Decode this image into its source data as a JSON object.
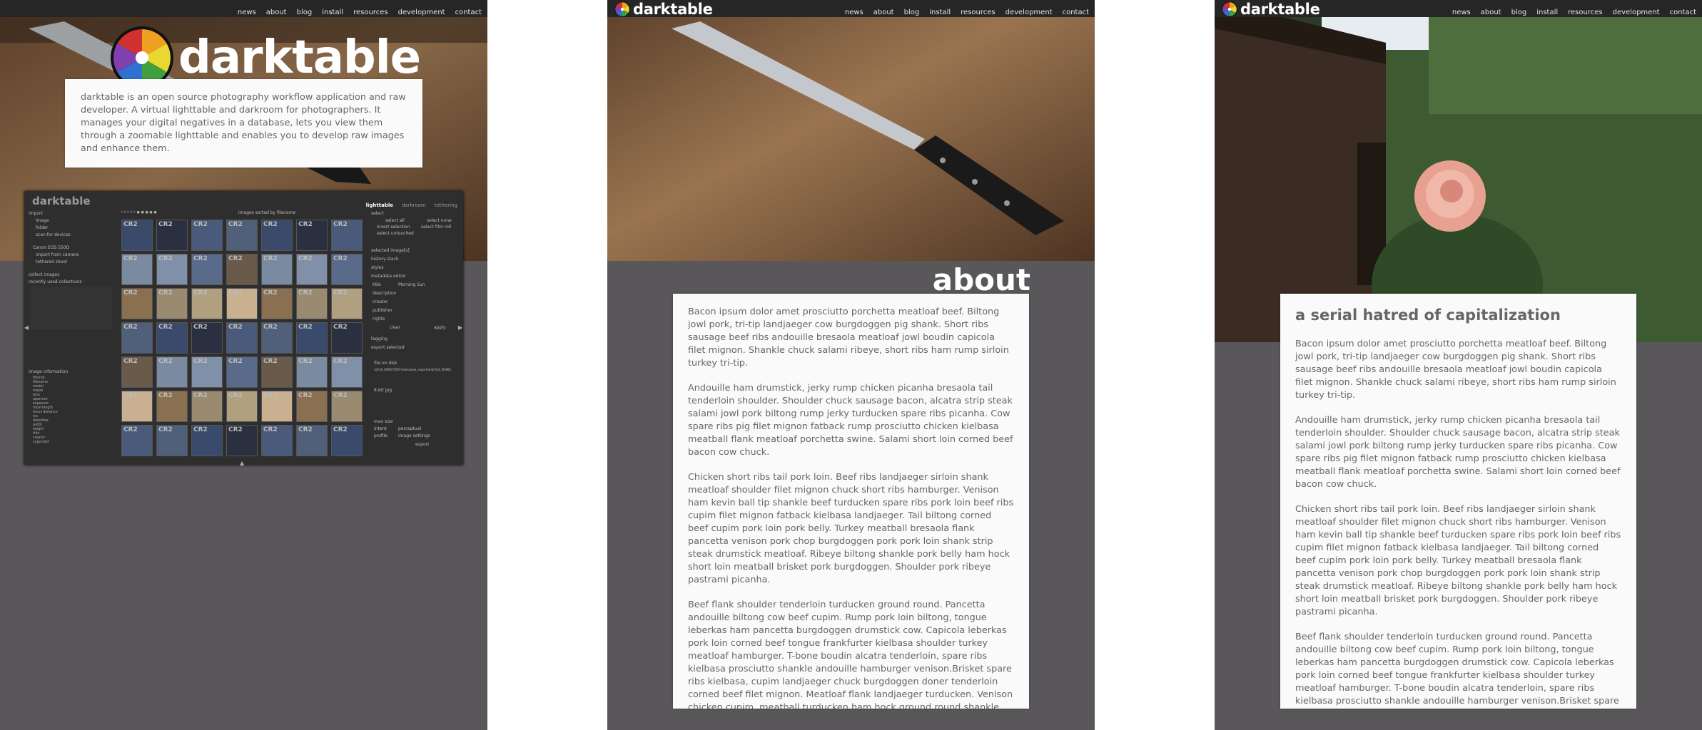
{
  "nav": {
    "items": [
      "news",
      "about",
      "blog",
      "install",
      "resources",
      "development",
      "contact"
    ]
  },
  "brand": {
    "name": "darktable"
  },
  "home": {
    "intro": "darktable is an open source photography workflow application and raw developer. A virtual lighttable and darkroom for photographers. It manages your digital negatives in a database, lets you view them through a zoomable lighttable and enables you to develop raw images and enhance them."
  },
  "app_screenshot": {
    "title": "darktable",
    "views": [
      "lighttable",
      "darkroom",
      "tethering"
    ],
    "sort_label": "images sorted by",
    "sort_value": "filename",
    "left_panel": {
      "import": "import",
      "import_items": [
        "image",
        "folder",
        "scan for devices"
      ],
      "device": "Canon EOS 550D",
      "device_items": [
        "import from camera",
        "tethered shoot"
      ],
      "collect": "collect images",
      "recent": "recently used collections",
      "image_info": "image information",
      "info_labels": [
        "filmroll",
        "filename",
        "model",
        "maker",
        "lens",
        "aperture",
        "exposure",
        "focal length",
        "focus distance",
        "iso",
        "datetime",
        "width",
        "height",
        "title",
        "creator",
        "copyright"
      ]
    },
    "right_panel": {
      "select": "select",
      "select_buttons": [
        "select all",
        "select none",
        "invert selection",
        "select film roll",
        "select untouched"
      ],
      "sections": [
        "selected image[s]",
        "history stack",
        "styles",
        "metadata editor",
        "tagging",
        "export selected"
      ],
      "metadata_fields": [
        "title",
        "description",
        "creator",
        "publisher",
        "rights"
      ],
      "metadata_title": "Morning Sun",
      "clear": "clear",
      "apply": "apply",
      "target": "file on disk",
      "path": "$(FILE_DIRECTORY)/darktable_exported/$(FILE_NAME)",
      "format": "8-bit jpg",
      "size": "max size",
      "intent": "intent",
      "profile": "profile",
      "profile_value": "image settings",
      "intent_value": "perceptual",
      "export": "export"
    },
    "thumb_label": "CR2"
  },
  "about": {
    "heading": "about",
    "paragraphs": [
      "Bacon ipsum dolor amet prosciutto porchetta meatloaf beef. Biltong jowl pork, tri-tip landjaeger cow burgdoggen pig shank. Short ribs sausage beef ribs andouille bresaola meatloaf jowl boudin capicola filet mignon. Shankle chuck salami ribeye, short ribs ham rump sirloin turkey tri-tip.",
      "Andouille ham drumstick, jerky rump chicken picanha bresaola tail tenderloin shoulder. Shoulder chuck sausage bacon, alcatra strip steak salami jowl pork biltong rump jerky turducken spare ribs picanha. Cow spare ribs pig filet mignon fatback rump prosciutto chicken kielbasa meatball flank meatloaf porchetta swine. Salami short loin corned beef bacon cow chuck.",
      "Chicken short ribs tail pork loin. Beef ribs landjaeger sirloin shank meatloaf shoulder filet mignon chuck short ribs hamburger. Venison ham kevin ball tip shankle beef turducken spare ribs pork loin beef ribs cupim filet mignon fatback kielbasa landjaeger. Tail biltong corned beef cupim pork loin pork belly. Turkey meatball bresaola flank pancetta venison pork chop burgdoggen pork pork loin shank strip steak drumstick meatloaf. Ribeye biltong shankle pork belly ham hock short loin meatball brisket pork burgdoggen. Shoulder pork ribeye pastrami picanha.",
      "Beef flank shoulder tenderloin turducken ground round. Pancetta andouille biltong cow beef cupim. Rump pork loin biltong, tongue leberkas ham pancetta burgdoggen drumstick cow. Capicola leberkas pork loin corned beef tongue frankfurter kielbasa shoulder turkey meatloaf hamburger. T-bone boudin alcatra tenderloin, spare ribs kielbasa prosciutto shankle andouille hamburger venison.Brisket spare ribs kielbasa, cupim landjaeger chuck burgdoggen doner tenderloin corned beef filet mignon. Meatloaf flank landjaeger turducken. Venison chicken cupim, meatball turducken ham hock ground round shankle prosciutto boudin pork belly pork chop"
    ]
  },
  "blog": {
    "title": "a serial hatred of capitalization",
    "paragraphs": [
      "Bacon ipsum dolor amet prosciutto porchetta meatloaf beef. Biltong jowl pork, tri-tip landjaeger cow burgdoggen pig shank. Short ribs sausage beef ribs andouille bresaola meatloaf jowl boudin capicola filet mignon. Shankle chuck salami ribeye, short ribs ham rump sirloin turkey tri-tip.",
      "Andouille ham drumstick, jerky rump chicken picanha bresaola tail tenderloin shoulder. Shoulder chuck sausage bacon, alcatra strip steak salami jowl pork biltong rump jerky turducken spare ribs picanha. Cow spare ribs pig filet mignon fatback rump prosciutto chicken kielbasa meatball flank meatloaf porchetta swine. Salami short loin corned beef bacon cow chuck.",
      "Chicken short ribs tail pork loin. Beef ribs landjaeger sirloin shank meatloaf shoulder filet mignon chuck short ribs hamburger. Venison ham kevin ball tip shankle beef turducken spare ribs pork loin beef ribs cupim filet mignon fatback kielbasa landjaeger. Tail biltong corned beef cupim pork loin pork belly. Turkey meatball bresaola flank pancetta venison pork chop burgdoggen pork pork loin shank strip steak drumstick meatloaf. Ribeye biltong shankle pork belly ham hock short loin meatball brisket pork burgdoggen. Shoulder pork ribeye pastrami picanha.",
      "Beef flank shoulder tenderloin turducken ground round. Pancetta andouille biltong cow beef cupim. Rump pork loin biltong, tongue leberkas ham pancetta burgdoggen drumstick cow. Capicola leberkas pork loin corned beef tongue frankfurter kielbasa shoulder turkey meatloaf hamburger. T-bone boudin alcatra tenderloin, spare ribs kielbasa prosciutto shankle andouille hamburger venison.Brisket spare ribs kielbasa, cupim landjaeger chuck burgdoggen doner tenderloin corned beef filet mignon. Meatloaf"
    ]
  },
  "colors": {
    "nav_bg": "#262626",
    "panel_bg": "#59575a",
    "card_bg": "#fafafa",
    "text": "#666666"
  }
}
